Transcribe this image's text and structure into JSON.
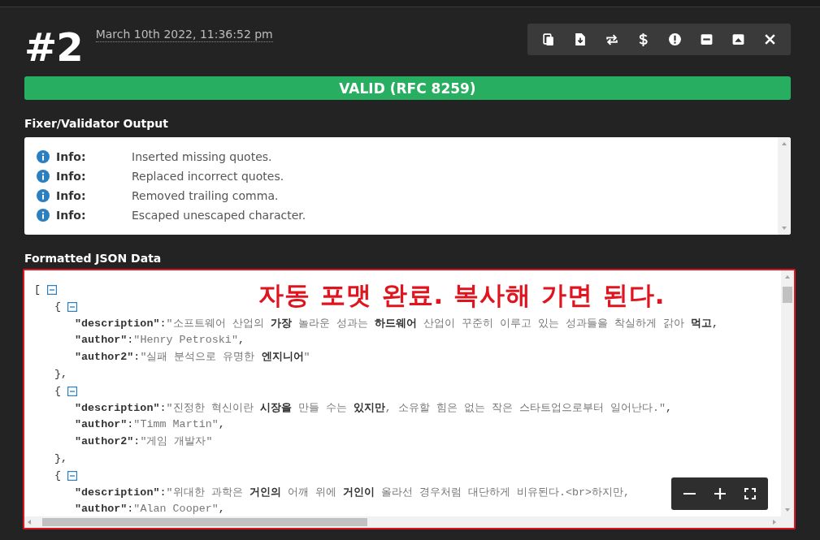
{
  "entry": {
    "number": "#2",
    "timestamp": "March 10th 2022, 11:36:52 pm"
  },
  "status": {
    "text": "VALID (RFC 8259)",
    "valid": true
  },
  "output": {
    "title": "Fixer/Validator Output",
    "messages": [
      {
        "kind": "info",
        "label": "Info:",
        "text": "Inserted missing quotes."
      },
      {
        "kind": "info",
        "label": "Info:",
        "text": "Replaced incorrect quotes."
      },
      {
        "kind": "info",
        "label": "Info:",
        "text": "Removed trailing comma."
      },
      {
        "kind": "info",
        "label": "Info:",
        "text": "Escaped unescaped character."
      }
    ]
  },
  "formatted": {
    "title": "Formatted JSON Data",
    "annotation": "자동 포맷 완료. 복사해 가면 된다.",
    "tree": {
      "open": "[",
      "expanded": true,
      "children": [
        {
          "open": "{",
          "expanded": true,
          "close": "},",
          "children": [
            {
              "key": "\"description\"",
              "sep": ":",
              "value": "\"소프트웨어 산업의 **가장** 놀라운 성과는 **하드웨어** 산업이 꾸준히 이루고 있는 성과들을 착실하게 갉아 **먹고**",
              "comma": ","
            },
            {
              "key": "\"author\"",
              "sep": ":",
              "value": "\"Henry Petroski\"",
              "comma": ","
            },
            {
              "key": "\"author2\"",
              "sep": ":",
              "value": "\"실패 분석으로 유명한 **엔지니어**\""
            }
          ]
        },
        {
          "open": "{",
          "expanded": true,
          "close": "},",
          "children": [
            {
              "key": "\"description\"",
              "sep": ":",
              "value": "\"진정한 혁신이란 **시장을** 만들 수는 **있지만**, 소유할 힘은 없는 작은 스타트업으로부터 일어난다.\"",
              "comma": ","
            },
            {
              "key": "\"author\"",
              "sep": ":",
              "value": "\"Timm Martin\"",
              "comma": ","
            },
            {
              "key": "\"author2\"",
              "sep": ":",
              "value": "\"게임 개발자\""
            }
          ]
        },
        {
          "open": "{",
          "expanded": true,
          "children": [
            {
              "key": "\"description\"",
              "sep": ":",
              "value": "\"위대한 과학은 **거인의** 어깨 위에 **거인이** 올라선 경우처럼 대단하게 비유된다.<br>하지만,"
            },
            {
              "key": "\"author\"",
              "sep": ":",
              "value": "\"Alan Cooper\"",
              "comma": ","
            }
          ]
        }
      ]
    }
  }
}
